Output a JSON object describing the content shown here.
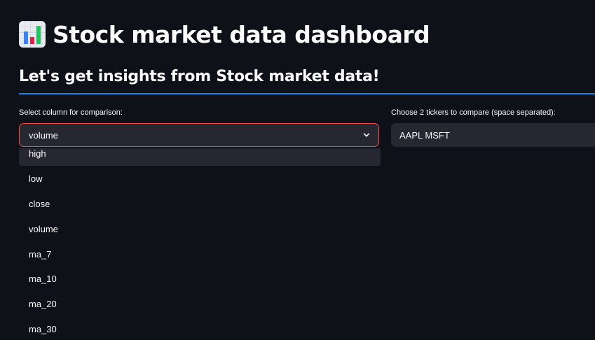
{
  "header": {
    "title": "Stock market data dashboard",
    "icon": "bar-chart-icon",
    "subtitle": "Let's get insights from Stock market data!"
  },
  "column_select": {
    "label": "Select column for comparison:",
    "value": "volume",
    "options": [
      "high",
      "low",
      "close",
      "volume",
      "ma_7",
      "ma_10",
      "ma_20",
      "ma_30"
    ]
  },
  "tickers_input": {
    "label": "Choose 2 tickers to compare (space separated):",
    "value": "AAPL MSFT"
  },
  "colors": {
    "background": "#0e1117",
    "widget": "#262730",
    "accent_focus": "#ff4b4b",
    "divider": "#1c83e1"
  }
}
